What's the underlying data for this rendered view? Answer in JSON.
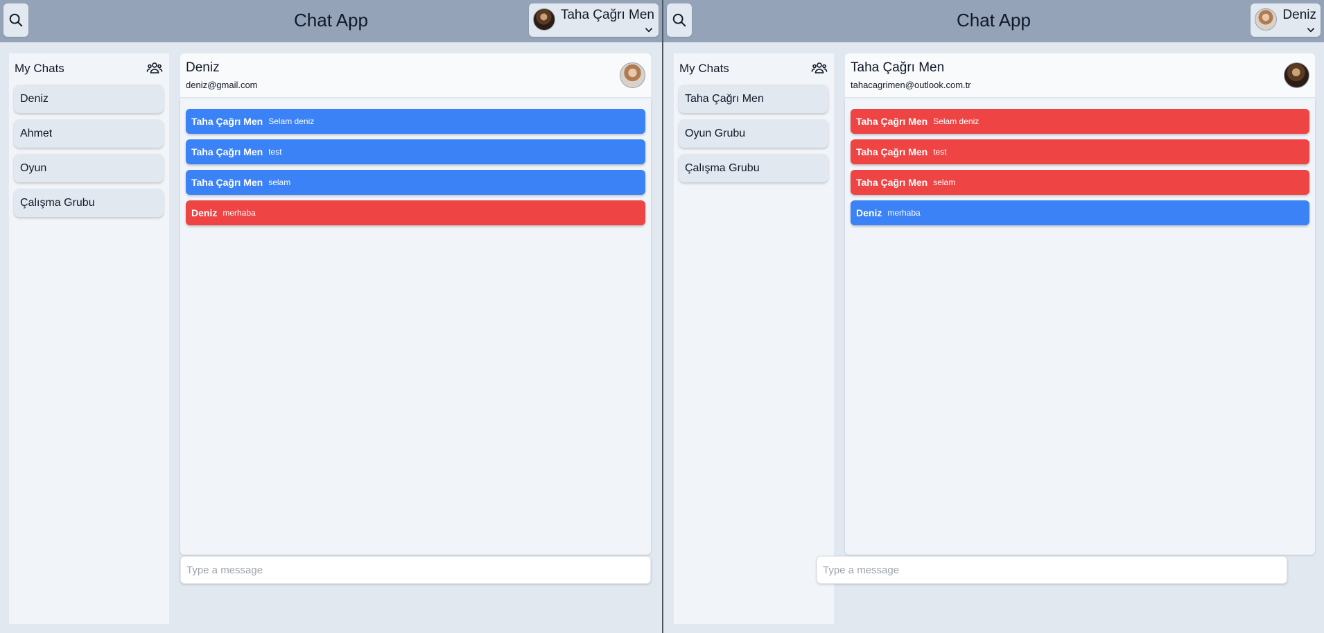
{
  "panes": {
    "left": {
      "app_title": "Chat App",
      "current_user": "Taha Çağrı Men",
      "sidebar_title": "My Chats",
      "chats": [
        "Deniz",
        "Ahmet",
        "Oyun",
        "Çalışma Grubu"
      ],
      "active_chat": {
        "name": "Deniz",
        "email": "deniz@gmail.com"
      },
      "messages": [
        {
          "sender": "Taha Çağrı Men",
          "text": "Selam deniz",
          "color": "#3b82f6"
        },
        {
          "sender": "Taha Çağrı Men",
          "text": "test",
          "color": "#3b82f6"
        },
        {
          "sender": "Taha Çağrı Men",
          "text": "selam",
          "color": "#3b82f6"
        },
        {
          "sender": "Deniz",
          "text": "merhaba",
          "color": "#ef4444"
        }
      ],
      "composer_placeholder": "Type a message"
    },
    "right": {
      "app_title": "Chat App",
      "current_user": "Deniz",
      "sidebar_title": "My Chats",
      "chats": [
        "Taha Çağrı Men",
        "Oyun Grubu",
        "Çalışma Grubu"
      ],
      "active_chat": {
        "name": "Taha Çağrı Men",
        "email": "tahacagrimen@outlook.com.tr"
      },
      "messages": [
        {
          "sender": "Taha Çağrı Men",
          "text": "Selam deniz",
          "color": "#ef4444"
        },
        {
          "sender": "Taha Çağrı Men",
          "text": "test",
          "color": "#ef4444"
        },
        {
          "sender": "Taha Çağrı Men",
          "text": "selam",
          "color": "#ef4444"
        },
        {
          "sender": "Deniz",
          "text": "merhaba",
          "color": "#3b82f6"
        }
      ],
      "composer_placeholder": "Type a message"
    }
  },
  "icons": {
    "search": "search-icon",
    "group": "user-group-icon",
    "chevron": "chevron-down-icon"
  },
  "colors": {
    "header": "#94a3b8",
    "outgoing_left": "#3b82f6",
    "incoming_left": "#ef4444"
  }
}
